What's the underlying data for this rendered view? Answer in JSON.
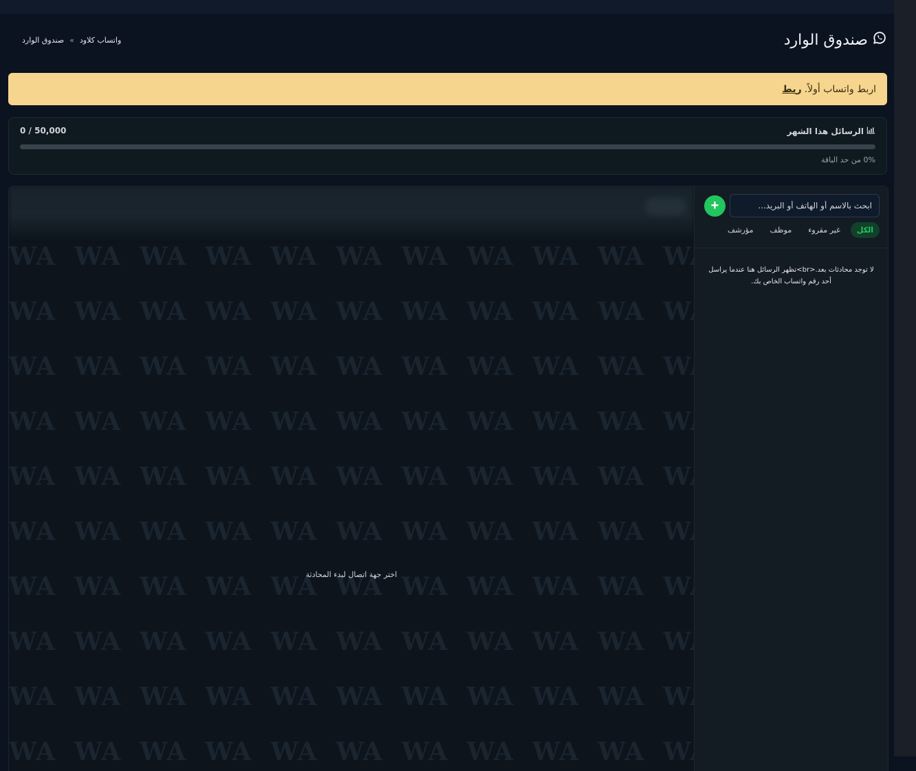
{
  "header": {
    "title": "صندوق الوارد",
    "title_icon": "whatsapp-icon",
    "breadcrumb": [
      "واتساب كلاود",
      "صندوق الوارد"
    ],
    "breadcrumb_separator": "»"
  },
  "alert": {
    "text": "اربط واتساب أولاً.",
    "link_label": "ربط",
    "background": "#f6d58e"
  },
  "usage": {
    "title": "الرسائل هذا الشهر",
    "title_icon": "bar-chart-icon",
    "count": "0 / 50,000",
    "progress_fraction": 0,
    "note": "0% من حد الباقة",
    "accent": "#22c55e"
  },
  "chat": {
    "watermark": "WA",
    "empty_text": "اختر جهة اتصال لبدء المحادثة"
  },
  "sidebar": {
    "search_placeholder": "ابحث بالاسم أو الهاتف أو البريد...",
    "add_icon": "plus-icon",
    "filters": [
      {
        "label": "الكل",
        "active": true
      },
      {
        "label": "غير مقروء",
        "active": false
      },
      {
        "label": "موظف",
        "active": false
      },
      {
        "label": "مؤرشف",
        "active": false
      }
    ],
    "empty_text": "لا توجد محادثات بعد.<br>تظهر الرسائل هنا عندما يراسل أحد رقم واتساب الخاص بك."
  }
}
